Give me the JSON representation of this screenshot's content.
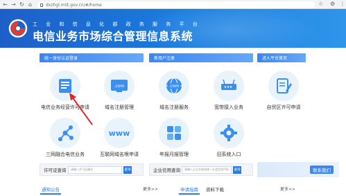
{
  "browser": {
    "url": "dxzhgl.miit.gov.cn/#/home",
    "back_icon": "arrow-left",
    "forward_icon": "arrow-right",
    "reload_icon": "reload",
    "home_icon": "home"
  },
  "header": {
    "subtitle": "工 业 和 信 息 化 部 政 务 服 务 平 台",
    "title": "电信业务市场综合管理信息系统",
    "gradient_start": "#1d5fc8",
    "gradient_end": "#2f95ea"
  },
  "sections": {
    "login": "统一身份认证登录",
    "register": "新用户注册",
    "platform": "进入平台首页"
  },
  "services": [
    {
      "label": "电信业务经营许可申请",
      "icon": "document-icon"
    },
    {
      "label": "域名注册管理",
      "icon": "com-domain-icon"
    },
    {
      "label": "域名注册服务",
      "icon": "globe-com-icon"
    },
    {
      "label": "宽带接入业务",
      "icon": "router-icon"
    },
    {
      "label": "自贸区许可申请",
      "icon": "edit-document-icon"
    },
    {
      "label": "三网融合电信业务",
      "icon": "network-nodes-icon"
    },
    {
      "label": "互联网域名根申请",
      "icon": "www-icon"
    },
    {
      "label": "年报月报管理",
      "icon": "grid-apps-icon"
    },
    {
      "label": "旧系统入口",
      "icon": "gear-icon"
    }
  ],
  "queries": {
    "license": {
      "label": "许可证查询",
      "placeholder": "请输入许可证编号",
      "button": "查询"
    },
    "company": {
      "label": "企业信用查询",
      "placeholder": "请输入企业名称或统一社会信用代码",
      "button": "查询"
    }
  },
  "contact": {
    "label": "联系我们"
  },
  "bottom": {
    "tab_notice": "通知公告",
    "more1": "更多>>",
    "tab_guide": "申请指南",
    "tab_download": "资料下载",
    "more2": "更多>>"
  },
  "colors": {
    "accent": "#2f7be6",
    "icon_blue": "#3b8ff0",
    "annotation_arrow": "#e0252b"
  }
}
